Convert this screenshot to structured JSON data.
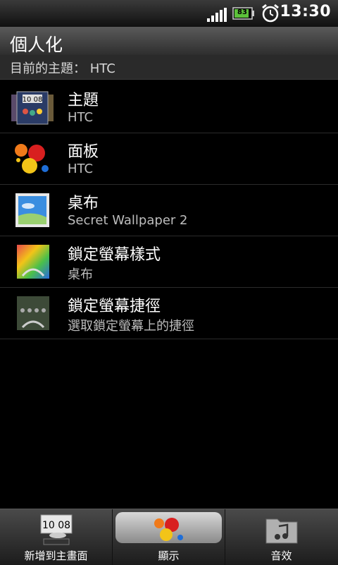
{
  "status_bar": {
    "battery_level": "83",
    "time": "13:30",
    "icons": [
      "signal-icon",
      "battery-icon",
      "alarm-clock-icon"
    ]
  },
  "header": {
    "title": "個人化",
    "current_theme": "目前的主題： HTC"
  },
  "list": [
    {
      "label": "主題",
      "sub": "HTC",
      "icon": "theme-icon"
    },
    {
      "label": "面板",
      "sub": "HTC",
      "icon": "skin-paint-splash-icon"
    },
    {
      "label": "桌布",
      "sub": "Secret Wallpaper 2",
      "icon": "wallpaper-icon"
    },
    {
      "label": "鎖定螢幕樣式",
      "sub": "桌布",
      "icon": "lockscreen-style-icon"
    },
    {
      "label": "鎖定螢幕捷徑",
      "sub": "選取鎖定螢幕上的捷徑",
      "icon": "lockscreen-shortcut-icon"
    }
  ],
  "tabs": [
    {
      "label": "新增到主畫面",
      "icon": "add-to-home-icon",
      "active": false
    },
    {
      "label": "顯示",
      "icon": "display-paint-icon",
      "active": true
    },
    {
      "label": "音效",
      "icon": "sound-folder-icon",
      "active": false
    }
  ],
  "clock_widget_text": "10 08"
}
